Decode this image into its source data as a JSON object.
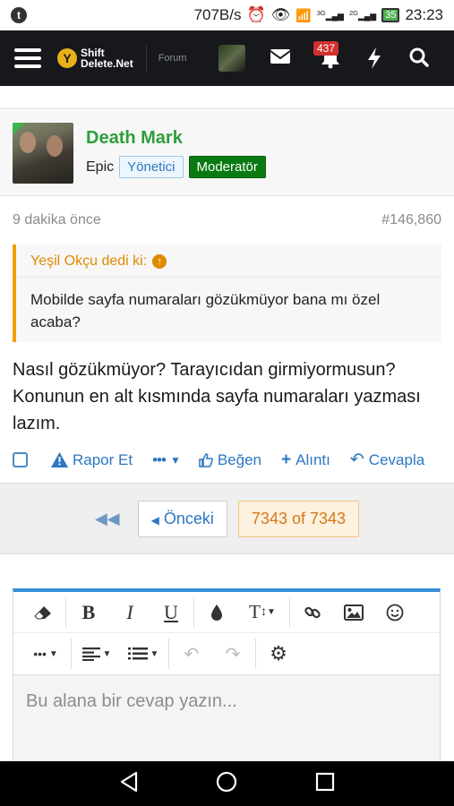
{
  "status_bar": {
    "net_speed": "707B/s",
    "signal_a_label": "3G",
    "signal_b_label": "2G",
    "battery": "35",
    "time": "23:23"
  },
  "navbar": {
    "logo_line1": "Shift",
    "logo_line2": "Delete.Net",
    "forum_label": "Forum",
    "notification_count": "437"
  },
  "post": {
    "username": "Death Mark",
    "rank": "Epic",
    "role_admin": "Yönetici",
    "role_moderator": "Moderatör",
    "time_ago": "9 dakika önce",
    "post_number": "#146,860",
    "quote": {
      "author_line": "Yeşil Okçu dedi ki:",
      "text": "Mobilde sayfa numaraları gözükmüyor bana mı özel acaba?"
    },
    "body": "Nasıl gözükmüyor? Tarayıcıdan girmiyormusun? Konunun en alt kısmında sayfa numaraları yazması lazım.",
    "actions": {
      "report": "Rapor Et",
      "more": "•••",
      "like": "Beğen",
      "quote": "Alıntı",
      "reply": "Cevapla"
    }
  },
  "pagination": {
    "prev_label": "Önceki",
    "current": "7343 of 7343"
  },
  "editor": {
    "placeholder": "Bu alana bir cevap yazın..."
  },
  "colors": {
    "brand_dark": "#16181c",
    "link_blue": "#2b77c0",
    "moderator_green": "#097a12",
    "quote_orange": "#f0a000",
    "editor_accent": "#3790d8"
  }
}
